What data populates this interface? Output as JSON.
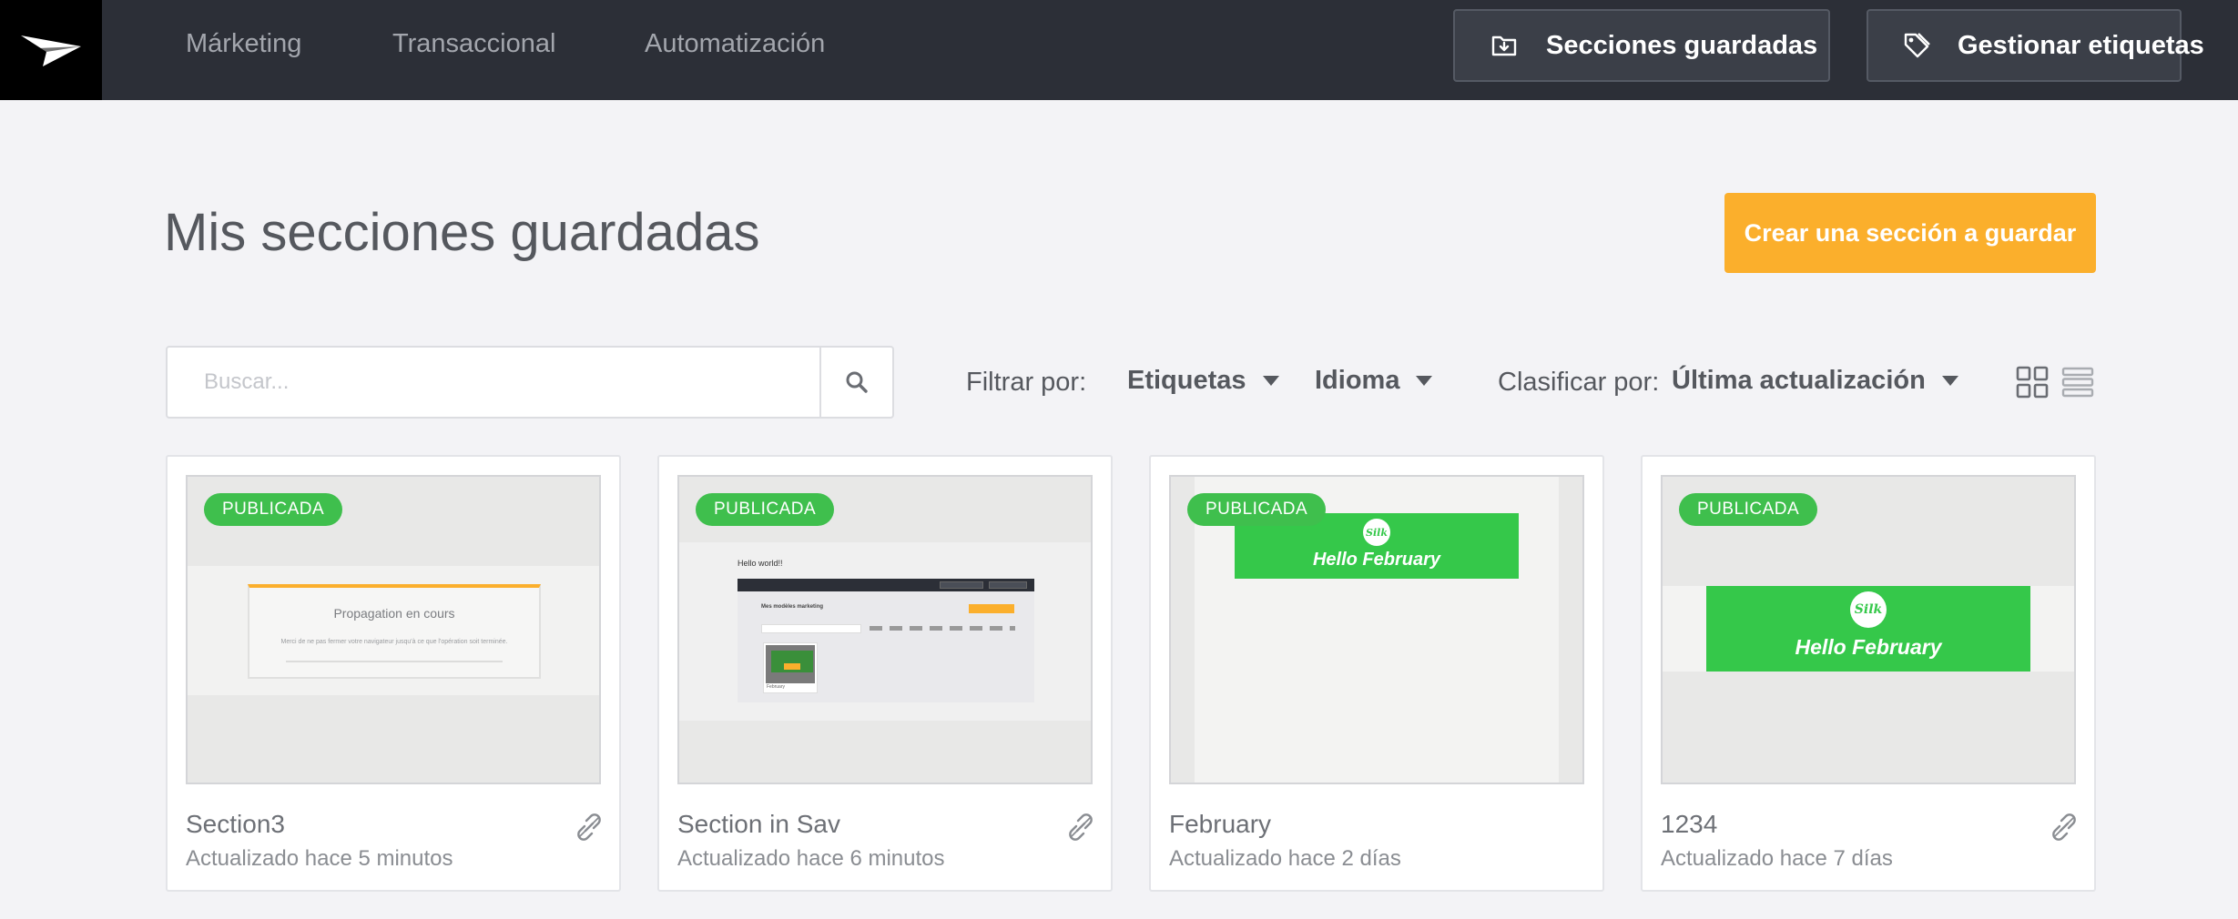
{
  "nav": {
    "items": [
      {
        "label": "Márketing"
      },
      {
        "label": "Transaccional"
      },
      {
        "label": "Automatización"
      }
    ],
    "saved_sections_label": "Secciones guardadas",
    "manage_tags_label": "Gestionar etiquetas"
  },
  "page": {
    "title": "Mis secciones guardadas",
    "create_button_label": "Crear una sección a guardar"
  },
  "search": {
    "placeholder": "Buscar...",
    "value": ""
  },
  "filters": {
    "filter_by_label": "Filtrar por:",
    "tags_label": "Etiquetas",
    "language_label": "Idioma",
    "sort_by_label": "Clasificar por:",
    "sort_value": "Última actualización"
  },
  "view_modes": [
    "grid-icon",
    "list-icon"
  ],
  "cards": [
    {
      "status": "PUBLICADA",
      "title": "Section3",
      "updated": "Actualizado hace 5 minutos",
      "thumb": {
        "heading": "Propagation en cours",
        "text": "Merci de ne pas fermer votre navigateur jusqu'à ce que l'opération soit terminée."
      }
    },
    {
      "status": "PUBLICADA",
      "title": "Section in Sav",
      "updated": "Actualizado hace 6 minutos",
      "thumb": {
        "heading": "Hello world!!",
        "inner_title": "Mes modèles marketing",
        "inner_card": "February"
      }
    },
    {
      "status": "PUBLICADA",
      "title": "February",
      "updated": "Actualizado hace 2 días",
      "thumb": {
        "logo": "Silk",
        "banner_text": "Hello February"
      }
    },
    {
      "status": "PUBLICADA",
      "title": "1234",
      "updated": "Actualizado hace 7 días",
      "thumb": {
        "logo": "Silk",
        "banner_text": "Hello February"
      }
    }
  ],
  "colors": {
    "topbar": "#2c2f37",
    "accent": "#fbaf2c",
    "badge": "#3fbf4d",
    "banner_green": "#35c84a"
  }
}
